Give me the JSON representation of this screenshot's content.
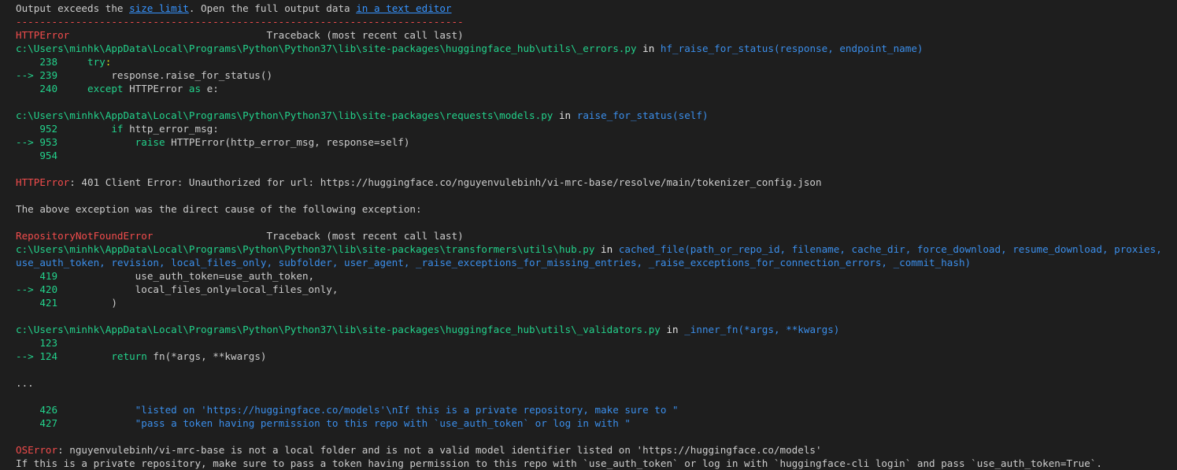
{
  "header": {
    "prefix": "Output exceeds the ",
    "size_limit_link": "size limit",
    "middle": ". Open the full output data ",
    "editor_link": "in a text editor"
  },
  "separator": "---------------------------------------------------------------------------",
  "block1": {
    "error_name": "HTTPError",
    "traceback_label": "                                 Traceback (most recent call last)",
    "frame1": {
      "path": "c:\\Users\\minhk\\AppData\\Local\\Programs\\Python\\Python37\\lib\\site-packages\\huggingface_hub\\utils\\_errors.py",
      "in": " in ",
      "func": "hf_raise_for_status(response, endpoint_name)",
      "lines": [
        {
          "arrow": "    ",
          "num": "238",
          "code_pre": "     ",
          "kw": "try",
          "code_post": ":"
        },
        {
          "arrow": "--> ",
          "num": "239",
          "code": "         response.raise_for_status()"
        },
        {
          "arrow": "    ",
          "num": "240",
          "code_pre": "     ",
          "kw": "except",
          "code_mid": " HTTPError ",
          "kw2": "as",
          "code_post": " e:"
        }
      ]
    },
    "frame2": {
      "path": "c:\\Users\\minhk\\AppData\\Local\\Programs\\Python\\Python37\\lib\\site-packages\\requests\\models.py",
      "in": " in ",
      "func": "raise_for_status(self)",
      "lines": [
        {
          "arrow": "    ",
          "num": "952",
          "code_pre": "         ",
          "kw": "if",
          "code_post": " http_error_msg:"
        },
        {
          "arrow": "--> ",
          "num": "953",
          "code_pre": "             ",
          "kw": "raise",
          "code_post": " HTTPError(http_error_msg, response=self)"
        },
        {
          "arrow": "    ",
          "num": "954",
          "code": ""
        }
      ]
    },
    "final_name": "HTTPError",
    "final_msg": ": 401 Client Error: Unauthorized for url: https://huggingface.co/nguyenvulebinh/vi-mrc-base/resolve/main/tokenizer_config.json"
  },
  "cause_text": "The above exception was the direct cause of the following exception:",
  "block2": {
    "error_name": "RepositoryNotFoundError",
    "traceback_label": "                   Traceback (most recent call last)",
    "frame1": {
      "path": "c:\\Users\\minhk\\AppData\\Local\\Programs\\Python\\Python37\\lib\\site-packages\\transformers\\utils\\hub.py",
      "in": " in ",
      "func": "cached_file(path_or_repo_id, filename, cache_dir, force_download, resume_download, proxies,",
      "func_cont": "use_auth_token, revision, local_files_only, subfolder, user_agent, _raise_exceptions_for_missing_entries, _raise_exceptions_for_connection_errors, _commit_hash)",
      "lines": [
        {
          "arrow": "    ",
          "num": "419",
          "code": "             use_auth_token=use_auth_token,"
        },
        {
          "arrow": "--> ",
          "num": "420",
          "code": "             local_files_only=local_files_only,"
        },
        {
          "arrow": "    ",
          "num": "421",
          "code": "         )"
        }
      ]
    },
    "frame2": {
      "path": "c:\\Users\\minhk\\AppData\\Local\\Programs\\Python\\Python37\\lib\\site-packages\\huggingface_hub\\utils\\_validators.py",
      "in": " in ",
      "func": "_inner_fn(*args, **kwargs)",
      "lines": [
        {
          "arrow": "    ",
          "num": "123",
          "code": ""
        },
        {
          "arrow": "--> ",
          "num": "124",
          "code_pre": "         ",
          "kw": "return",
          "code_post": " fn(*args, **kwargs)"
        }
      ]
    },
    "ellipsis": "...",
    "frame3": {
      "lines": [
        {
          "arrow": "    ",
          "num": "426",
          "str": "             \"listed on 'https://huggingface.co/models'\\nIf this is a private repository, make sure to \""
        },
        {
          "arrow": "    ",
          "num": "427",
          "str": "             \"pass a token having permission to this repo with `use_auth_token` or log in with \""
        }
      ]
    },
    "final_name": "OSError",
    "final_msg": ": nguyenvulebinh/vi-mrc-base is not a local folder and is not a valid model identifier listed on 'https://huggingface.co/models'",
    "final_msg2": "If this is a private repository, make sure to pass a token having permission to this repo with `use_auth_token` or log in with `huggingface-cli login` and pass `use_auth_token=True`."
  }
}
